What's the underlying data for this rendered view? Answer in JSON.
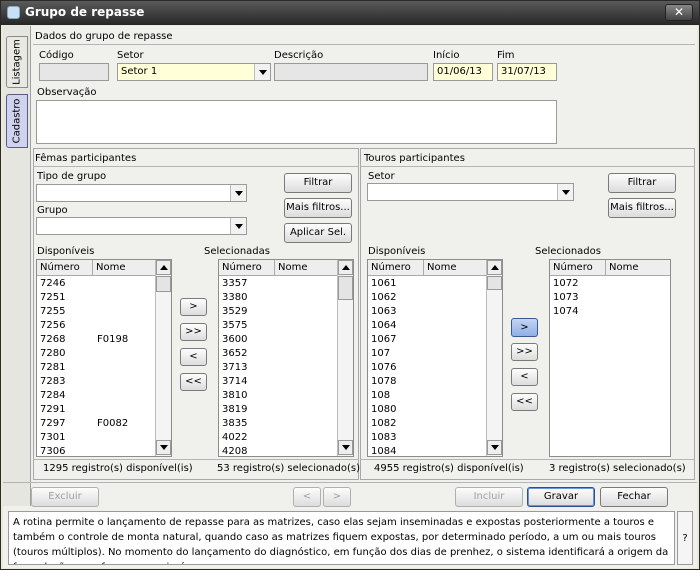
{
  "window": {
    "title": "Grupo de repasse",
    "close_label": "✕"
  },
  "vtabs": {
    "listagem": "Listagem",
    "cadastro": "Cadastro"
  },
  "dados": {
    "group_title": "Dados do grupo de repasse",
    "codigo_label": "Código",
    "codigo_value": "",
    "setor_label": "Setor",
    "setor_value": "Setor 1",
    "descricao_label": "Descrição",
    "descricao_value": "",
    "inicio_label": "Início",
    "inicio_value": "01/06/13",
    "fim_label": "Fim",
    "fim_value": "31/07/13",
    "observacao_label": "Observação",
    "observacao_value": ""
  },
  "femeas": {
    "group_title": "Fêmas participantes",
    "tipo_grupo_label": "Tipo de grupo",
    "tipo_grupo_value": "",
    "grupo_label": "Grupo",
    "grupo_value": "",
    "filtrar_label": "Filtrar",
    "mais_filtros_label": "Mais filtros...",
    "aplicar_sel_label": "Aplicar Sel.",
    "disponiveis_label": "Disponíveis",
    "selecionadas_label": "Selecionadas",
    "col_numero": "Número",
    "col_nome": "Nome",
    "disponiveis": [
      {
        "numero": "7246",
        "nome": ""
      },
      {
        "numero": "7251",
        "nome": ""
      },
      {
        "numero": "7255",
        "nome": ""
      },
      {
        "numero": "7256",
        "nome": ""
      },
      {
        "numero": "7268",
        "nome": "F0198"
      },
      {
        "numero": "7280",
        "nome": ""
      },
      {
        "numero": "7281",
        "nome": ""
      },
      {
        "numero": "7283",
        "nome": ""
      },
      {
        "numero": "7284",
        "nome": ""
      },
      {
        "numero": "7291",
        "nome": ""
      },
      {
        "numero": "7297",
        "nome": "F0082"
      },
      {
        "numero": "7301",
        "nome": ""
      },
      {
        "numero": "7306",
        "nome": ""
      }
    ],
    "selecionadas": [
      {
        "numero": "3357",
        "nome": ""
      },
      {
        "numero": "3380",
        "nome": ""
      },
      {
        "numero": "3529",
        "nome": ""
      },
      {
        "numero": "3575",
        "nome": ""
      },
      {
        "numero": "3600",
        "nome": ""
      },
      {
        "numero": "3652",
        "nome": ""
      },
      {
        "numero": "3713",
        "nome": ""
      },
      {
        "numero": "3714",
        "nome": ""
      },
      {
        "numero": "3810",
        "nome": ""
      },
      {
        "numero": "3819",
        "nome": ""
      },
      {
        "numero": "3835",
        "nome": ""
      },
      {
        "numero": "4022",
        "nome": ""
      },
      {
        "numero": "4208",
        "nome": ""
      }
    ],
    "btn_add": ">",
    "btn_add_all": ">>",
    "btn_remove": "<",
    "btn_remove_all": "<<",
    "count_disponiveis": "1295 registro(s) disponível(is)",
    "count_selecionadas": "53 registro(s) selecionado(s)"
  },
  "touros": {
    "group_title": "Touros participantes",
    "setor_label": "Setor",
    "setor_value": "",
    "filtrar_label": "Filtrar",
    "mais_filtros_label": "Mais filtros...",
    "disponiveis_label": "Disponíveis",
    "selecionados_label": "Selecionados",
    "col_numero": "Número",
    "col_nome": "Nome",
    "disponiveis": [
      {
        "numero": "1061",
        "nome": ""
      },
      {
        "numero": "1062",
        "nome": ""
      },
      {
        "numero": "1063",
        "nome": ""
      },
      {
        "numero": "1064",
        "nome": ""
      },
      {
        "numero": "1067",
        "nome": ""
      },
      {
        "numero": "107",
        "nome": ""
      },
      {
        "numero": "1076",
        "nome": ""
      },
      {
        "numero": "1078",
        "nome": ""
      },
      {
        "numero": "108",
        "nome": ""
      },
      {
        "numero": "1080",
        "nome": ""
      },
      {
        "numero": "1082",
        "nome": ""
      },
      {
        "numero": "1083",
        "nome": ""
      },
      {
        "numero": "1084",
        "nome": ""
      }
    ],
    "selecionados": [
      {
        "numero": "1072",
        "nome": ""
      },
      {
        "numero": "1073",
        "nome": ""
      },
      {
        "numero": "1074",
        "nome": ""
      }
    ],
    "btn_add": ">",
    "btn_add_all": ">>",
    "btn_remove": "<",
    "btn_remove_all": "<<",
    "count_disponiveis": "4955 registro(s) disponível(is)",
    "count_selecionados": "3 registro(s) selecionado(s)"
  },
  "footer": {
    "excluir_label": "Excluir",
    "prev_label": "<",
    "next_label": ">",
    "incluir_label": "Incluir",
    "gravar_label": "Gravar",
    "fechar_label": "Fechar"
  },
  "help": {
    "text": "A rotina permite o lançamento de repasse para as matrizes, caso elas sejam inseminadas e expostas posteriormente a touros e também o controle de monta natural, quando caso as matrizes fiquem expostas, por determinado período, a um ou mais touros (touros múltiplos). No momento do lançamento do diagnóstico, em função dos dias de prenhez, o sistema identificará a origem da fecundação e, se for o caso, criará,",
    "question_label": "?"
  }
}
